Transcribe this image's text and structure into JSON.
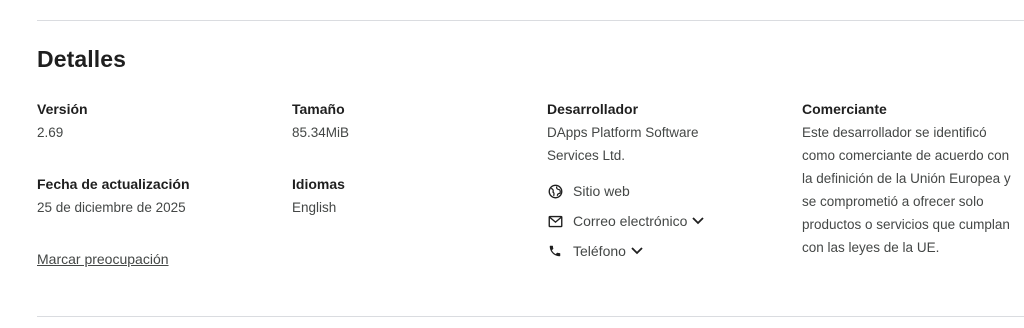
{
  "section": {
    "title": "Detalles"
  },
  "version": {
    "label": "Versión",
    "value": "2.69"
  },
  "size": {
    "label": "Tamaño",
    "value": "85.34MiB"
  },
  "updated": {
    "label": "Fecha de actualización",
    "value": "25 de diciembre de 2025"
  },
  "languages": {
    "label": "Idiomas",
    "value": "English"
  },
  "flag_link": "Marcar preocupación",
  "developer": {
    "label": "Desarrollador",
    "name": "DApps Platform Software Services Ltd.",
    "website": "Sitio web",
    "email": "Correo electrónico",
    "phone": "Teléfono"
  },
  "merchant": {
    "label": "Comerciante",
    "text": "Este desarrollador se identificó como comerciante de acuerdo con la definición de la Unión Europea y se comprometió a ofrecer solo productos o servicios que cumplan con las leyes de la UE."
  },
  "icons": {
    "website": "globe-icon",
    "email": "envelope-icon",
    "phone": "phone-icon",
    "chevron": "chevron-down-icon"
  }
}
